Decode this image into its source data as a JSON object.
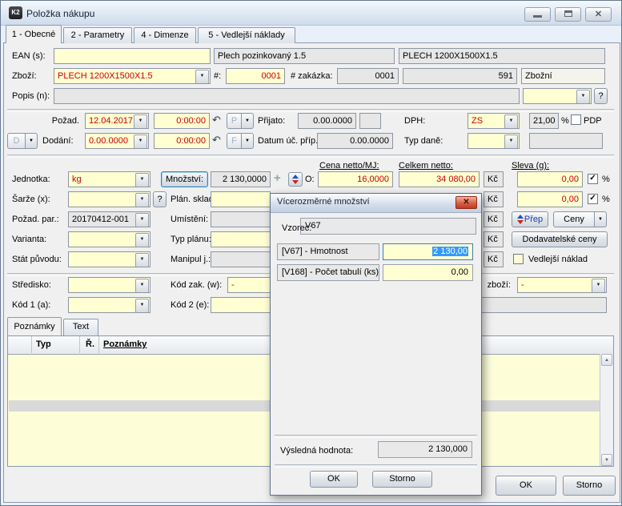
{
  "window": {
    "title": "Položka nákupu",
    "icon_text": "K2"
  },
  "tabs": [
    {
      "label": "1 - Obecné"
    },
    {
      "label": "2 - Parametry"
    },
    {
      "label": "4 - Dimenze"
    },
    {
      "label": "5 - Vedlejší náklady"
    }
  ],
  "top": {
    "ean_label": "EAN (s):",
    "name1": "Plech pozinkovaný 1.5",
    "name2": "PLECH 1200X1500X1.5",
    "zbozi_label": "Zboží:",
    "zbozi_value": "PLECH 1200X1500X1.5",
    "hash_label": "#:",
    "hash_value": "0001",
    "zakazka_label": "# zakázka:",
    "zakazka_value": "0001",
    "code_value": "591",
    "kind_value": "Zbožní",
    "popis_label": "Popis (n):"
  },
  "dates": {
    "pozad_label": "Požad.",
    "pozad_date": "12.04.2017",
    "pozad_time": "0:00:00",
    "p_btn": "P",
    "prijato_label": "Přijato:",
    "prijato_value": "0.00.0000",
    "dph_label": "DPH:",
    "dph_value": "ZS",
    "dph_rate": "21,00",
    "pct": "%",
    "pdp_label": "PDP",
    "d_btn": "D",
    "dodani_label": "Dodání:",
    "dodani_date": "0.00.0000",
    "dodani_time": "0:00:00",
    "f_btn": "F",
    "datum_uc_label": "Datum úč. příp.:",
    "datum_uc_value": "0.00.0000",
    "typ_dane_label": "Typ daně:"
  },
  "price": {
    "header_cena": "Cena netto/MJ:",
    "header_celkem": "Celkem netto:",
    "header_sleva": "Sleva (g):",
    "o_label": "O:",
    "cena": "16,0000",
    "celkem": "34 080,00",
    "mena": "Kč",
    "sleva1": "0,00",
    "sleva2": "0,00",
    "pct": "%",
    "prep_btn": "Přep",
    "ceny_btn": "Ceny",
    "dodavatelske_btn": "Dodavatelské ceny",
    "vedlejsi_label": "Vedlejší náklad",
    "zbozi_label": "zboží:",
    "zbozi_value": "-"
  },
  "form": {
    "jednotka_label": "Jednotka:",
    "jednotka_value": "kg",
    "mnozstvi_btn": "Množství:",
    "mnozstvi_value": "2 130,0000",
    "sarze_label": "Šarže (x):",
    "plan_sklad_label": "Plán. sklad:",
    "pozad_par_label": "Požad. par.:",
    "pozad_par_value": "20170412-001",
    "umisteni_label": "Umístění:",
    "varianta_label": "Varianta:",
    "typ_planu_label": "Typ plánu:",
    "stat_label": "Stát původu:",
    "manipul_label": "Manipul j.:",
    "stredisko_label": "Středisko:",
    "kod_zak_label": "Kód zak. (w):",
    "kod_zak_value": "-",
    "kod1_label": "Kód 1 (a):",
    "kod2_label": "Kód 2 (e):"
  },
  "notes": {
    "tab_poznamky": "Poznámky",
    "tab_text": "Text",
    "col_typ": "Typ",
    "col_r": "Ř.",
    "col_poznamky": "Poznámky"
  },
  "footer": {
    "ok": "OK",
    "storno": "Storno"
  },
  "dialog": {
    "title": "Vícerozměrné množství",
    "vzorec_label": "Vzorec:",
    "vzorec_value": "V67",
    "rows": [
      {
        "label": "[V67] - Hmotnost",
        "value": "2 130,00"
      },
      {
        "label": "[V168] - Počet tabulí (ks)",
        "value": "0,00"
      }
    ],
    "result_label": "Výsledná hodnota:",
    "result_value": "2 130,000",
    "ok": "OK",
    "storno": "Storno"
  },
  "icons": {
    "dropdown": "▼",
    "undo": "↶",
    "plus": "+",
    "help": "?",
    "check": "✓",
    "close": "✕",
    "scroll_up": "▲",
    "scroll_down": "▼"
  },
  "colors": {
    "accent_red": "#c80000",
    "field_yellow": "#ffffd2",
    "selection_blue": "#3399ff"
  }
}
